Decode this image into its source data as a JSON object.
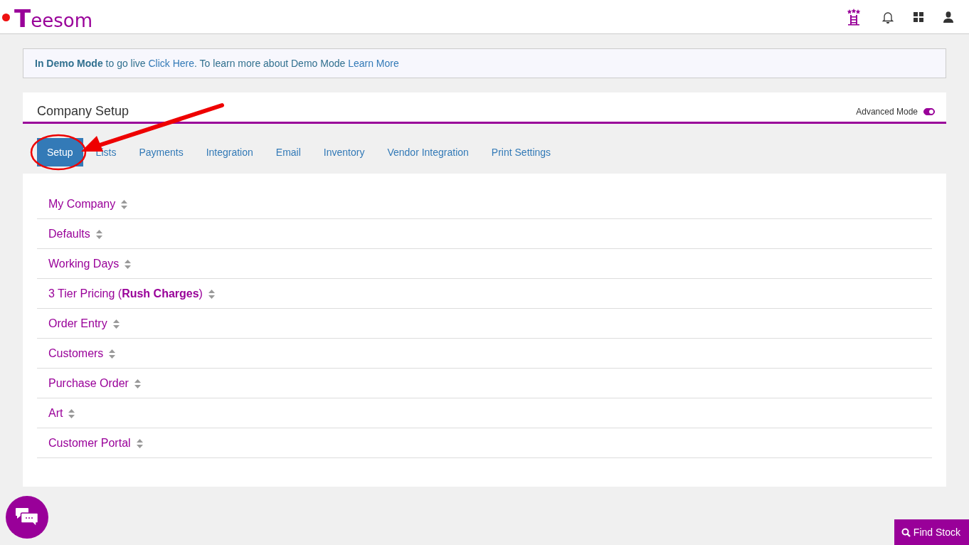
{
  "header": {
    "status_dot": {
      "color": "#ee1111"
    },
    "logo": "Teesom"
  },
  "banner": [
    {
      "kind": "bold",
      "text": "In Demo Mode"
    },
    {
      "kind": "text",
      "text": " to go live "
    },
    {
      "kind": "link",
      "text": "Click Here"
    },
    {
      "kind": "text",
      "text": ". To learn more about Demo Mode "
    },
    {
      "kind": "link",
      "text": "Learn More"
    }
  ],
  "panel": {
    "title": "Company Setup",
    "advanced_mode": {
      "label": "Advanced Mode",
      "on": true
    }
  },
  "tabs": [
    {
      "label": "Setup",
      "selected": true
    },
    {
      "label": "Lists",
      "selected": false
    },
    {
      "label": "Payments",
      "selected": false
    },
    {
      "label": "Integration",
      "selected": false
    },
    {
      "label": "Email",
      "selected": false
    },
    {
      "label": "Inventory",
      "selected": false
    },
    {
      "label": "Vendor Integration",
      "selected": false
    },
    {
      "label": "Print Settings",
      "selected": false
    }
  ],
  "sections": [
    "My Company",
    "Defaults",
    "Working Days",
    "3 Tier Pricing (**Rush Charges**)",
    "Order Entry",
    "Customers",
    "Purchase Order",
    "Art",
    "Customer Portal"
  ],
  "annotation": {
    "kind": "arrow"
  },
  "find_stock": {
    "label": "Find Stock"
  }
}
